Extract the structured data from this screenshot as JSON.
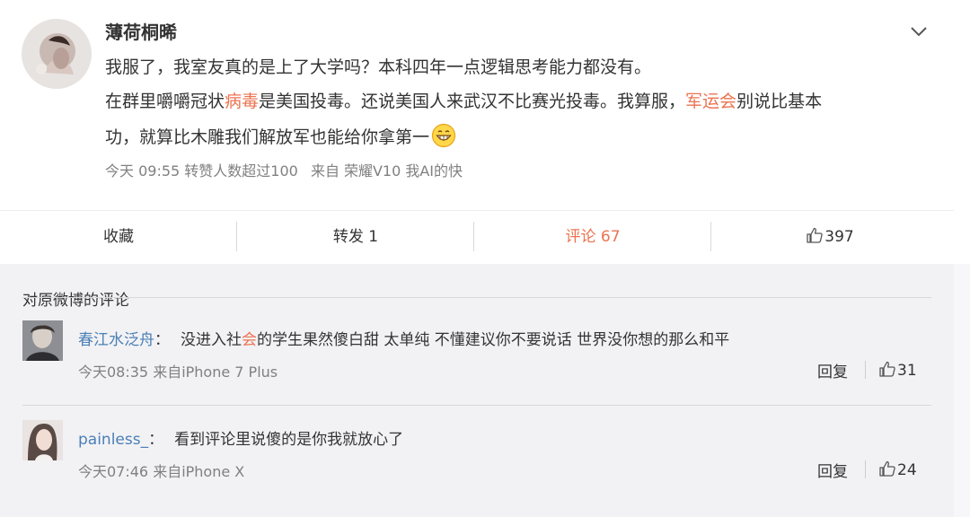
{
  "post": {
    "username": "薄荷桐晞",
    "line1": "我服了，我室友真的是上了大学吗？本科四年一点逻辑思考能力都没有。",
    "line2_a": "在群里嚼嚼冠状",
    "line2_hl1": "病毒",
    "line2_b": "是美国投毒。还说美国人来武汉不比赛光投毒。我算服，",
    "line2_hl2": "军运会",
    "line2_c": "别说比基本",
    "line3": "功，就算比木雕我们解放军也能给你拿第一",
    "emoji": "grin-emoji",
    "meta_time": "今天 09:55",
    "meta_repost": "转赞人数超过100",
    "meta_from": "来自",
    "meta_device": "荣耀V10 我AI的快"
  },
  "actions": {
    "favorite": "收藏",
    "repost": "转发 1",
    "comment": "评论 67",
    "like_count": "397"
  },
  "comments": {
    "title": "对原微博的评论",
    "items": [
      {
        "user": "春江水泛舟",
        "colon": "：",
        "text_a": "没进入社",
        "text_hl": "会",
        "text_b": "的学生果然傻白甜 太单纯 不懂建议你不要说话 世界没你想的那么和平",
        "time": "今天08:35 来自iPhone 7 Plus",
        "reply": "回复",
        "likes": "31"
      },
      {
        "user": "painless_",
        "colon": "：",
        "text_a": "看到评论里说傻的是你我就放心了",
        "time": "今天07:46 来自iPhone X",
        "reply": "回复",
        "likes": "24"
      }
    ]
  },
  "colors": {
    "accent": "#eb7350",
    "link": "#4b7fb5",
    "muted": "#808080",
    "comment_bg": "#f2f2f5"
  }
}
